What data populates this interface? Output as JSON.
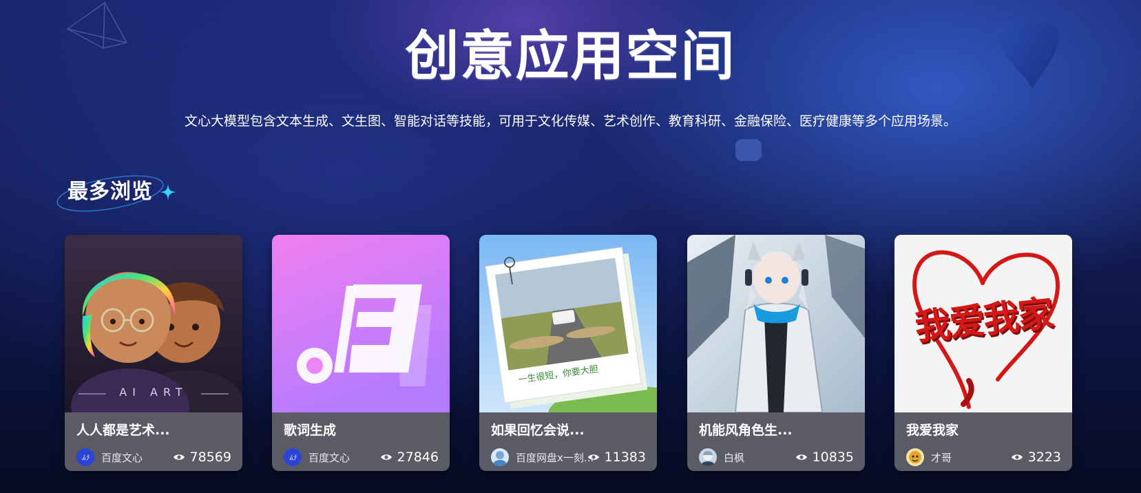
{
  "header": {
    "title": "创意应用空间",
    "subtitle": "文心大模型包含文本生成、文生图、智能对话等技能，可用于文化传媒、艺术创作、教育科研、金融保险、医疗健康等多个应用场景。"
  },
  "section": {
    "title": "最多浏览"
  },
  "cards": [
    {
      "title": "人人都是艺术...",
      "image_text": "AI ART",
      "author": "百度文心",
      "views": "78569",
      "avatar_icon": "ernie-logo-icon"
    },
    {
      "title": "歌词生成",
      "image_text": "",
      "author": "百度文心",
      "views": "27846",
      "avatar_icon": "ernie-logo-icon"
    },
    {
      "title": "如果回忆会说...",
      "image_text": "一生很短，你要大胆",
      "author": "百度网盘x一刻...",
      "views": "11383",
      "avatar_icon": "user-avatar-icon"
    },
    {
      "title": "机能风角色生...",
      "image_text": "",
      "author": "白枫",
      "views": "10835",
      "avatar_icon": "user-avatar-icon"
    },
    {
      "title": "我爱我家",
      "image_text": "我爱我家",
      "author": "才哥",
      "views": "3223",
      "avatar_icon": "user-avatar-icon"
    }
  ],
  "colors": {
    "accent_cyan": "#35d6ff",
    "card_footer": "#5f5f69",
    "heart_red": "#d41818"
  }
}
